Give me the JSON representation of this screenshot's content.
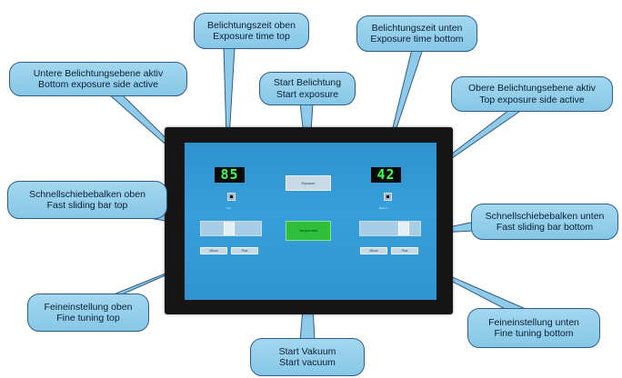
{
  "display": {
    "timer_top": "85",
    "timer_bottom": "42",
    "start_exposure_button": "Exposure",
    "start_vacuum_button": "Vacuum start",
    "top_side_label": "Top",
    "bottom_side_label": "Bottom",
    "fine_top_minus": "Minus",
    "fine_top_plus": "Plus",
    "fine_bottom_minus": "Minus",
    "fine_bottom_plus": "Plus",
    "slider_top_value": 0.45,
    "slider_bottom_value": 0.75
  },
  "callouts": [
    {
      "id": "exposure-time-top",
      "line1": "Belichtungszeit oben",
      "line2": "Exposure time top"
    },
    {
      "id": "exposure-time-bottom",
      "line1": "Belichtungszeit unten",
      "line2": "Exposure time bottom"
    },
    {
      "id": "bottom-side-active",
      "line1": "Untere Belichtungsebene aktiv",
      "line2": "Bottom exposure side active"
    },
    {
      "id": "start-exposure",
      "line1": "Start Belichtung",
      "line2": "Start exposure"
    },
    {
      "id": "top-side-active",
      "line1": "Obere Belichtungsebene aktiv",
      "line2": "Top exposure side active"
    },
    {
      "id": "fast-bar-top",
      "line1": "Schnellschiebebalken oben",
      "line2": "Fast sliding bar top"
    },
    {
      "id": "fast-bar-bottom",
      "line1": "Schnellschiebebalken unten",
      "line2": "Fast sliding bar bottom"
    },
    {
      "id": "fine-tuning-top",
      "line1": "Feineinstellung oben",
      "line2": "Fine tuning top"
    },
    {
      "id": "fine-tuning-bottom",
      "line1": "Feineinstellung unten",
      "line2": "Fine tuning bottom"
    },
    {
      "id": "start-vacuum",
      "line1": "Start Vakuum",
      "line2": "Start vacuum"
    }
  ],
  "colors": {
    "screen": "#379fd9",
    "digits": "#38ff4a",
    "bubble": "#9fd5ee",
    "bubble_border": "#2e5d87",
    "vacuum_button": "#2fbf3a"
  }
}
